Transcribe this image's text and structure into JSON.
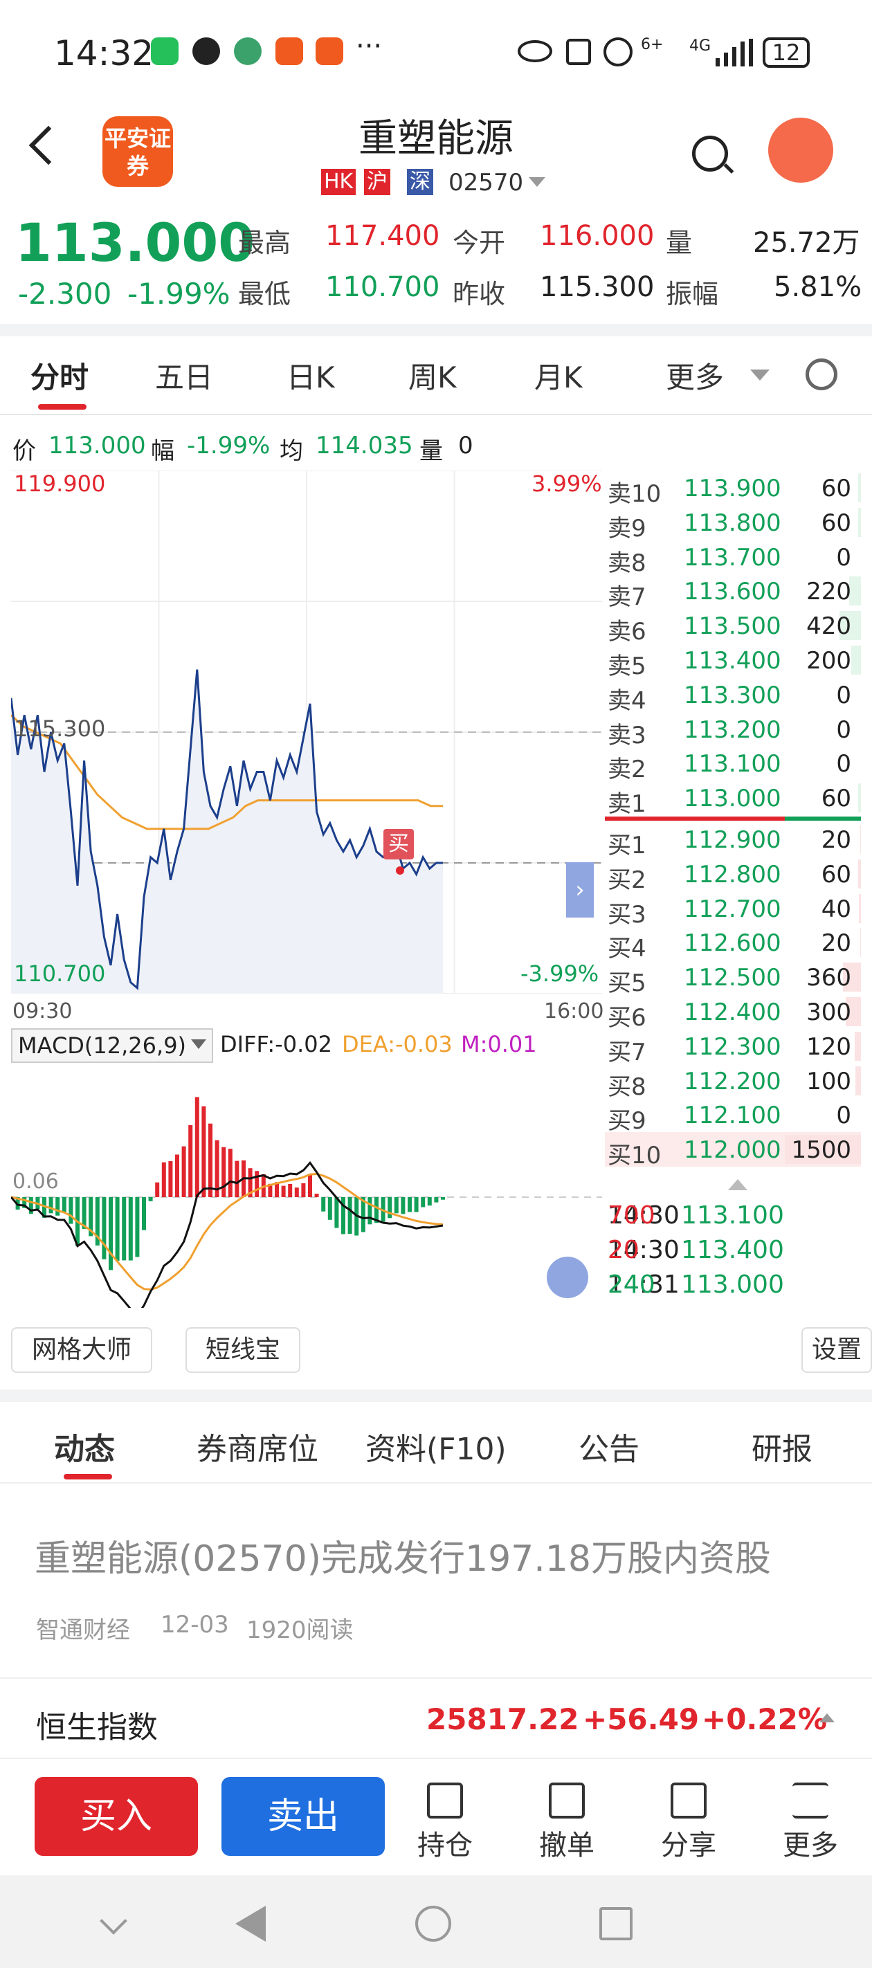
{
  "status_bar": {
    "time": "14:32",
    "battery": "12",
    "signal_text": "4G",
    "wifi_text": "6+",
    "more": "···"
  },
  "header": {
    "back": "<",
    "broker_logo": "平安证券",
    "stock_name": "重塑能源",
    "markets": [
      "HK",
      "沪",
      "深"
    ],
    "code": "02570"
  },
  "quote": {
    "price": "113.000",
    "change": "-2.300",
    "change_pct": "-1.99%",
    "high_label": "最高",
    "high": "117.400",
    "low_label": "最低",
    "low": "110.700",
    "open_label": "今开",
    "open": "116.000",
    "prev_close_label": "昨收",
    "prev_close": "115.300",
    "volume_label": "量",
    "volume": "25.72万",
    "amplitude_label": "振幅",
    "amplitude": "5.81%"
  },
  "tabs": [
    "分时",
    "五日",
    "日K",
    "周K",
    "月K",
    "更多"
  ],
  "chart_info": {
    "price_label": "价",
    "price": "113.000",
    "pct_label": "幅",
    "pct": "-1.99%",
    "avg_label": "均",
    "avg": "114.035",
    "vol_label": "量",
    "vol": "0"
  },
  "chart_labels": {
    "top_price": "119.900",
    "top_pct": "3.99%",
    "mid_price": "115.300",
    "bottom_price": "110.700",
    "bottom_pct": "-3.99%",
    "start_time": "09:30",
    "end_time": "16:00",
    "buy_marker": "买",
    "macd_base": "0.06"
  },
  "macd": {
    "label": "MACD(12,26,9)",
    "diff": "DIFF:-0.02",
    "dea": "DEA:-0.03",
    "m": "M:0.01"
  },
  "order_book": {
    "asks": [
      {
        "label": "卖10",
        "price": "113.900",
        "qty": "60",
        "level": 0.04
      },
      {
        "label": "卖9",
        "price": "113.800",
        "qty": "60",
        "level": 0.04
      },
      {
        "label": "卖8",
        "price": "113.700",
        "qty": "0",
        "level": 0
      },
      {
        "label": "卖7",
        "price": "113.600",
        "qty": "220",
        "level": 0.15
      },
      {
        "label": "卖6",
        "price": "113.500",
        "qty": "420",
        "level": 0.28
      },
      {
        "label": "卖5",
        "price": "113.400",
        "qty": "200",
        "level": 0.13
      },
      {
        "label": "卖4",
        "price": "113.300",
        "qty": "0",
        "level": 0
      },
      {
        "label": "卖3",
        "price": "113.200",
        "qty": "0",
        "level": 0
      },
      {
        "label": "卖2",
        "price": "113.100",
        "qty": "0",
        "level": 0
      },
      {
        "label": "卖1",
        "price": "113.000",
        "qty": "60",
        "level": 0.04
      }
    ],
    "bids": [
      {
        "label": "买1",
        "price": "112.900",
        "qty": "20",
        "level": 0.01
      },
      {
        "label": "买2",
        "price": "112.800",
        "qty": "60",
        "level": 0.04
      },
      {
        "label": "买3",
        "price": "112.700",
        "qty": "40",
        "level": 0.03
      },
      {
        "label": "买4",
        "price": "112.600",
        "qty": "20",
        "level": 0.01
      },
      {
        "label": "买5",
        "price": "112.500",
        "qty": "360",
        "level": 0.24
      },
      {
        "label": "买6",
        "price": "112.400",
        "qty": "300",
        "level": 0.2
      },
      {
        "label": "买7",
        "price": "112.300",
        "qty": "120",
        "level": 0.08
      },
      {
        "label": "买8",
        "price": "112.200",
        "qty": "100",
        "level": 0.07
      },
      {
        "label": "买9",
        "price": "112.100",
        "qty": "0",
        "level": 0
      },
      {
        "label": "买10",
        "price": "112.000",
        "qty": "1500",
        "level": 1.0
      }
    ]
  },
  "ticks": [
    {
      "time": "14:30",
      "price": "113.100",
      "qty": "700",
      "color": "#e1252d"
    },
    {
      "time": "14:30",
      "price": "113.400",
      "qty": "20",
      "color": "#e1252d"
    },
    {
      "time": "14:31",
      "price": "113.000",
      "qty": "240",
      "color": "#12a058"
    }
  ],
  "tools": {
    "grid_master": "网格大师",
    "short_line": "短线宝",
    "settings": "设置"
  },
  "news_tabs": [
    "动态",
    "券商席位",
    "资料(F10)",
    "公告",
    "研报"
  ],
  "news": {
    "title": "重塑能源(02570)完成发行197.18万股内资股",
    "source": "智通财经",
    "date": "12-03",
    "reads": "1920阅读"
  },
  "index": {
    "name": "恒生指数",
    "value": "25817.22",
    "change": "+56.49",
    "pct": "+0.22%"
  },
  "bottom": {
    "buy": "买入",
    "sell": "卖出",
    "position": "持仓",
    "cancel": "撤单",
    "share": "分享",
    "more": "更多"
  },
  "colors": {
    "up": "#e1252d",
    "down": "#12a058",
    "avg_line": "#f0a030",
    "price_line": "#1c3f8c",
    "blue_btn": "#1f6fe0"
  },
  "chart_data": {
    "type": "line",
    "title": "",
    "y_range": [
      110.7,
      119.9
    ],
    "reference": 115.3,
    "series": [
      {
        "values": [
          115.9,
          114.9,
          115.6,
          115.0,
          115.6,
          114.6,
          115.3,
          114.8,
          115.1,
          113.9,
          112.6,
          114.8,
          113.2,
          112.6,
          111.7,
          111.2,
          112.1,
          111.3,
          110.9,
          110.8,
          112.4,
          113.1,
          113.0,
          113.6,
          112.7,
          113.2,
          113.6,
          115.0,
          116.4,
          114.6,
          114.0,
          113.8,
          114.3,
          114.7,
          114.0,
          114.8,
          114.3,
          114.6,
          114.6,
          114.1,
          114.8,
          114.5,
          114.9,
          114.6,
          115.2,
          115.8,
          113.9,
          113.5,
          113.7,
          113.4,
          113.2,
          113.4,
          113.1,
          113.3,
          113.6,
          113.2,
          113.1,
          113.2,
          113.3,
          112.9,
          113.0,
          112.8,
          113.1,
          112.9,
          113.0,
          113.0
        ]
      },
      {
        "values": [
          115.6,
          115.4,
          115.3,
          115.2,
          115.1,
          114.8,
          114.5,
          114.2,
          114.0,
          113.8,
          113.7,
          113.6,
          113.6,
          113.6,
          113.6,
          113.6,
          113.6,
          113.7,
          113.8,
          114.0,
          114.1,
          114.1,
          114.1,
          114.1,
          114.1,
          114.1,
          114.1,
          114.1,
          114.1,
          114.1,
          114.1,
          114.1,
          114.1,
          114.1,
          114.0,
          114.0
        ]
      }
    ]
  }
}
